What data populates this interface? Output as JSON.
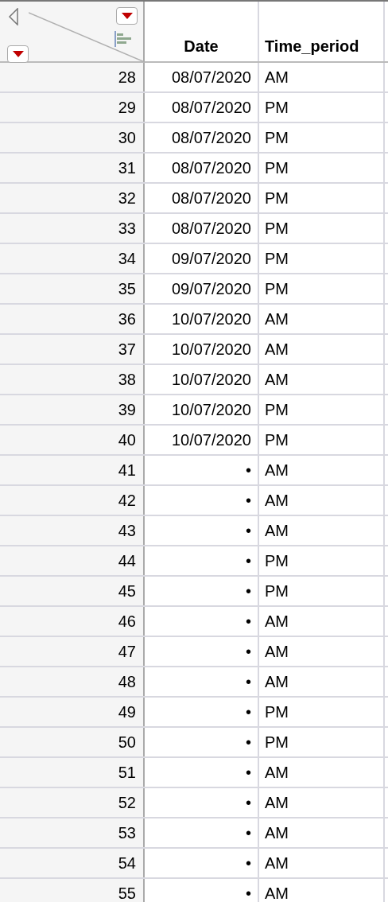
{
  "columns": [
    "Date",
    "Time_period"
  ],
  "rows": [
    {
      "row": "28",
      "date": "08/07/2020",
      "period": "AM"
    },
    {
      "row": "29",
      "date": "08/07/2020",
      "period": "PM"
    },
    {
      "row": "30",
      "date": "08/07/2020",
      "period": "PM"
    },
    {
      "row": "31",
      "date": "08/07/2020",
      "period": "PM"
    },
    {
      "row": "32",
      "date": "08/07/2020",
      "period": "PM"
    },
    {
      "row": "33",
      "date": "08/07/2020",
      "period": "PM"
    },
    {
      "row": "34",
      "date": "09/07/2020",
      "period": "PM"
    },
    {
      "row": "35",
      "date": "09/07/2020",
      "period": "PM"
    },
    {
      "row": "36",
      "date": "10/07/2020",
      "period": "AM"
    },
    {
      "row": "37",
      "date": "10/07/2020",
      "period": "AM"
    },
    {
      "row": "38",
      "date": "10/07/2020",
      "period": "AM"
    },
    {
      "row": "39",
      "date": "10/07/2020",
      "period": "PM"
    },
    {
      "row": "40",
      "date": "10/07/2020",
      "period": "PM"
    },
    {
      "row": "41",
      "date": "•",
      "period": "AM"
    },
    {
      "row": "42",
      "date": "•",
      "period": "AM"
    },
    {
      "row": "43",
      "date": "•",
      "period": "AM"
    },
    {
      "row": "44",
      "date": "•",
      "period": "PM"
    },
    {
      "row": "45",
      "date": "•",
      "period": "PM"
    },
    {
      "row": "46",
      "date": "•",
      "period": "AM"
    },
    {
      "row": "47",
      "date": "•",
      "period": "AM"
    },
    {
      "row": "48",
      "date": "•",
      "period": "AM"
    },
    {
      "row": "49",
      "date": "•",
      "period": "PM"
    },
    {
      "row": "50",
      "date": "•",
      "period": "PM"
    },
    {
      "row": "51",
      "date": "•",
      "period": "AM"
    },
    {
      "row": "52",
      "date": "•",
      "period": "AM"
    },
    {
      "row": "53",
      "date": "•",
      "period": "AM"
    },
    {
      "row": "54",
      "date": "•",
      "period": "AM"
    },
    {
      "row": "55",
      "date": "•",
      "period": "AM"
    }
  ]
}
